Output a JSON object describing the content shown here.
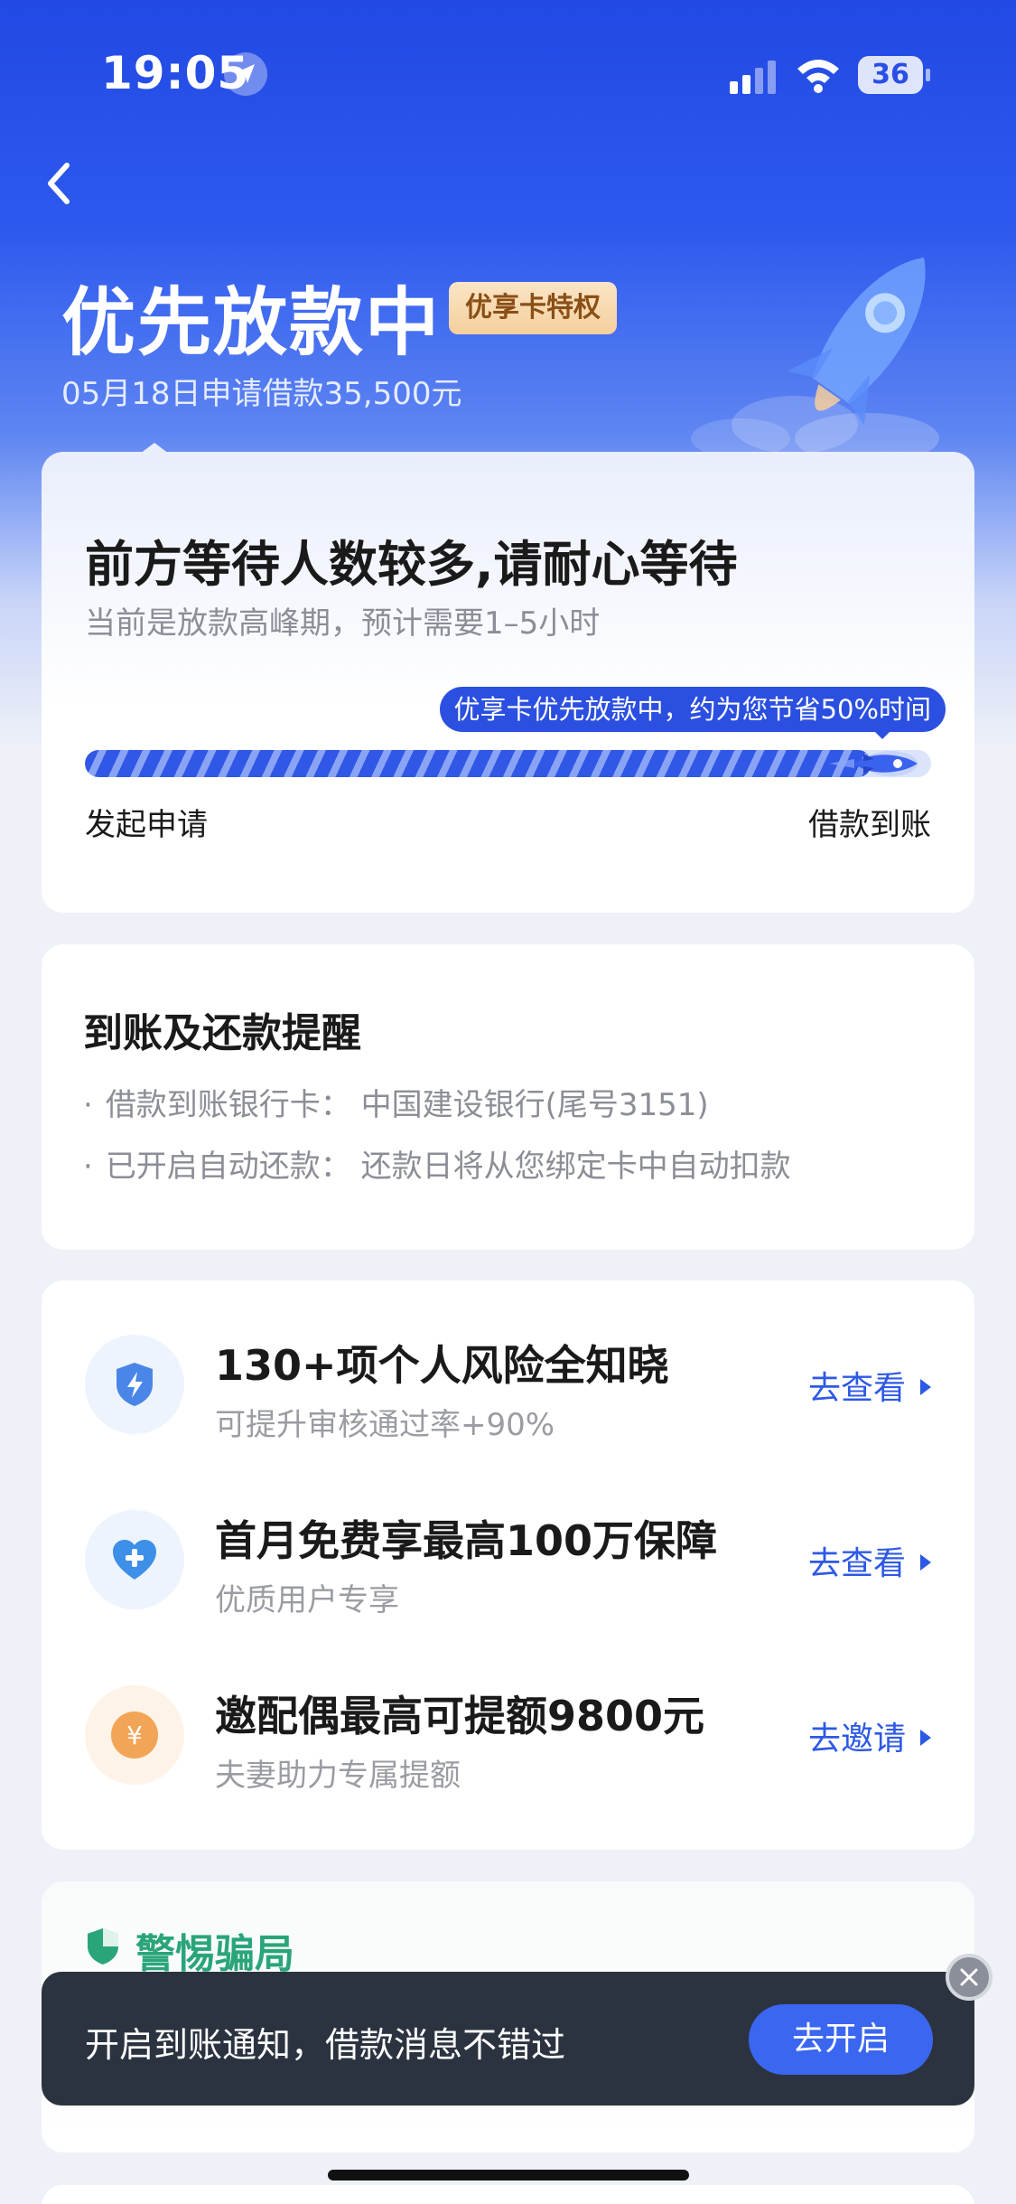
{
  "status_bar": {
    "time": "19:05",
    "battery": "36"
  },
  "header": {
    "title": "优先放款中",
    "badge": "优享卡特权",
    "subtitle": "05月18日申请借款35,500元"
  },
  "progress": {
    "title": "前方等待人数较多,请耐心等待",
    "subtitle": "当前是放款高峰期，预计需要1–5小时",
    "tip": "优享卡优先放款中，约为您节省50%时间",
    "start_label": "发起申请",
    "end_label": "借款到账",
    "fill_fraction": 0.93
  },
  "reminder": {
    "title": "到账及还款提醒",
    "items": [
      "借款到账银行卡：  中国建设银行(尾号3151)",
      "已开启自动还款：  还款日将从您绑定卡中自动扣款"
    ]
  },
  "offers": [
    {
      "title": "130+项个人风险全知晓",
      "subtitle": "可提升审核通过率+90%",
      "action": "去查看",
      "icon": "shield-bolt-icon",
      "color": "#4a86e8"
    },
    {
      "title": "首月免费享最高100万保障",
      "subtitle": "优质用户专享",
      "action": "去查看",
      "icon": "heart-plus-icon",
      "color": "#3d8fe8"
    },
    {
      "title": "邀配偶最高可提额9800元",
      "subtitle": "夫妻助力专属提额",
      "action": "去邀请",
      "icon": "yen-coin-icon",
      "color": "#f2a556"
    }
  ],
  "fraud": {
    "title": "警惕骗局"
  },
  "toast": {
    "text": "开启到账通知，借款消息不错过",
    "button": "去开启"
  },
  "colors": {
    "brand_blue": "#2d59e6",
    "fraud_green": "#2aa57a",
    "badge_brown": "#8a4f16"
  }
}
